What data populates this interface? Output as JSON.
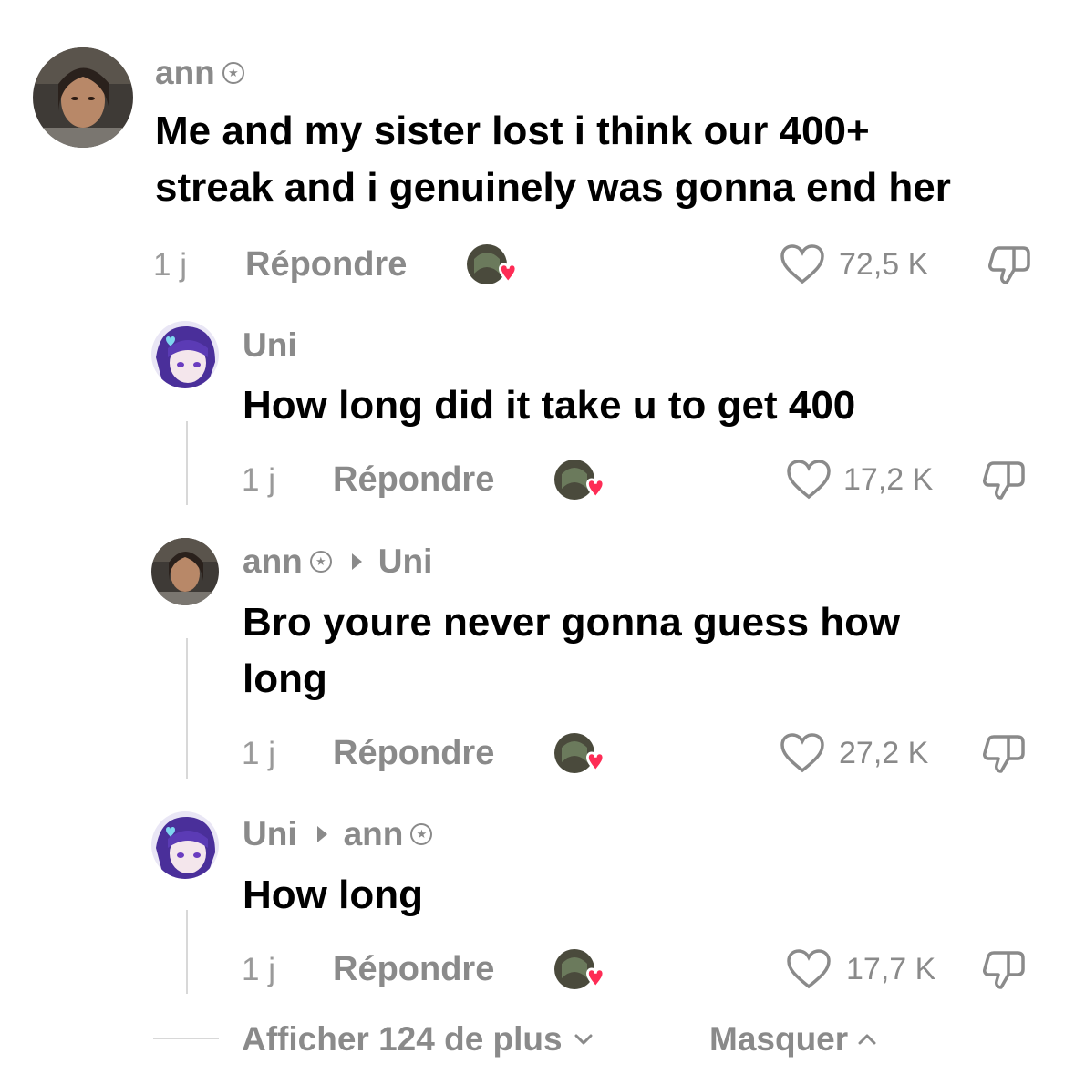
{
  "comments": [
    {
      "author": "ann",
      "verified": true,
      "reply_to": "",
      "text_lines": [
        "Me and my sister lost i think our 400+",
        "streak and i genuinely was gonna end her"
      ],
      "time": "1 j",
      "reply_label": "Répondre",
      "likes": "72,5 K"
    },
    {
      "author": "Uni",
      "verified": false,
      "reply_to": "",
      "text_lines": [
        "How long did it take u to get 400"
      ],
      "time": "1 j",
      "reply_label": "Répondre",
      "likes": "17,2 K"
    },
    {
      "author": "ann",
      "verified": true,
      "reply_to": "Uni",
      "text_lines": [
        "Bro youre never gonna guess how",
        "long"
      ],
      "time": "1 j",
      "reply_label": "Répondre",
      "likes": "27,2 K"
    },
    {
      "author": "Uni",
      "verified": false,
      "reply_to": "ann",
      "text_lines": [
        "How long"
      ],
      "time": "1 j",
      "reply_label": "Répondre",
      "likes": "17,7 K"
    }
  ],
  "footer": {
    "show_more_label": "Afficher 124 de plus",
    "hide_label": "Masquer"
  },
  "colors": {
    "heart_badge": "#fe2c55",
    "secondary_text": "#8a8a8a",
    "primary_text": "#000000"
  }
}
